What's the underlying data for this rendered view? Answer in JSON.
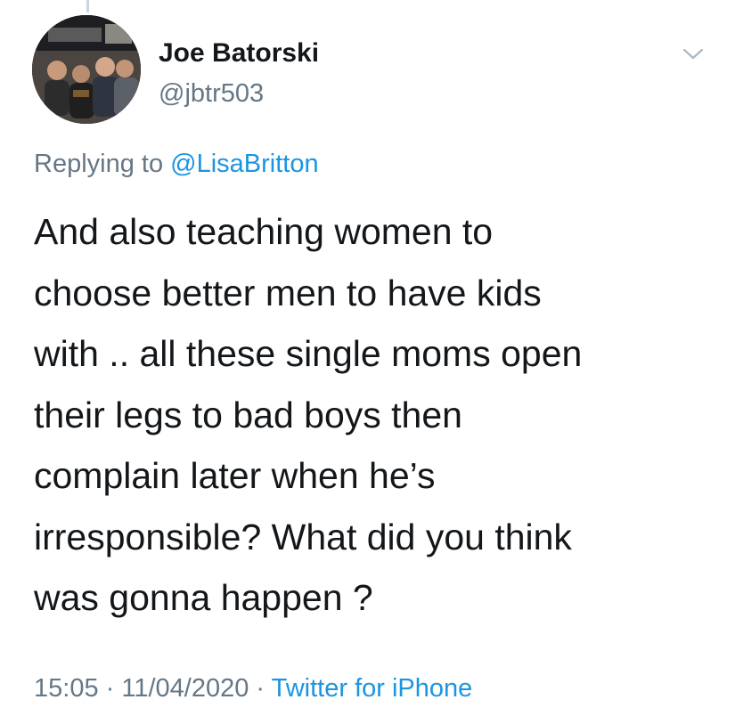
{
  "tweet": {
    "author_name": "Joe Batorski",
    "author_handle": "@jbtr503",
    "replying_prefix": "Replying to ",
    "replying_to": "@LisaBritton",
    "body": "And also teaching women to\nchoose better men to have kids\nwith .. all these single moms open\ntheir legs to bad boys then\ncomplain later when he’s\nirresponsible? What did you think\nwas gonna happen ?",
    "time": "15:05",
    "separator": " · ",
    "date": "11/04/2020",
    "source": "Twitter for iPhone"
  },
  "icons": {
    "menu": "chevron-down-icon",
    "avatar": "profile-photo"
  },
  "colors": {
    "text": "#14171a",
    "secondary": "#657786",
    "link": "#1b95e0",
    "thread_line": "#ccd6dd"
  }
}
